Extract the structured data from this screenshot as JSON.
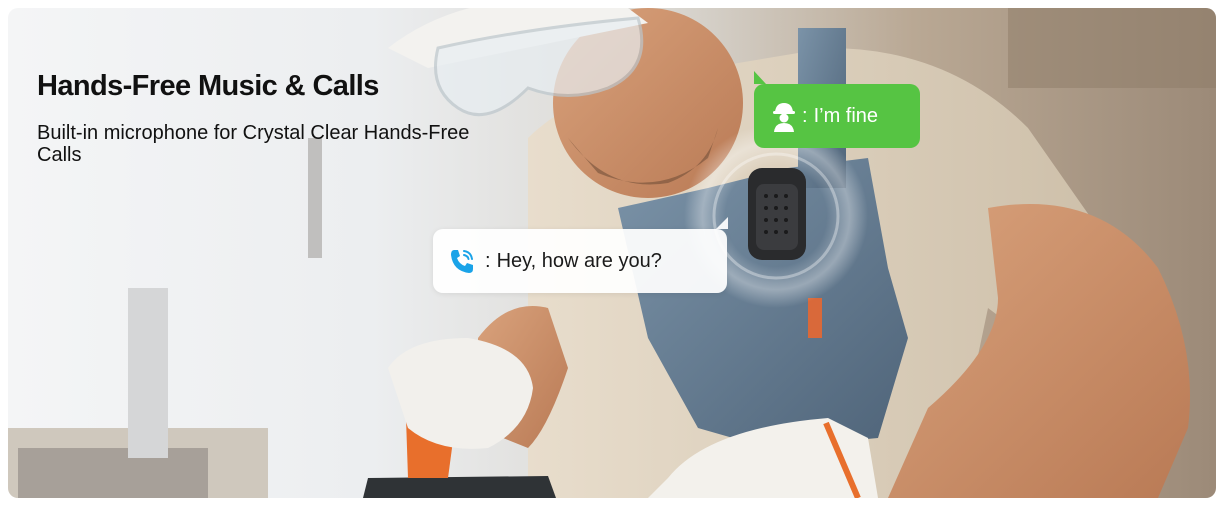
{
  "banner": {
    "headline": "Hands-Free Music & Calls",
    "subline": "Built-in microphone for Crystal Clear Hands-Free Calls"
  },
  "chat": {
    "reply_prefix": ":",
    "reply_text": "I’m fine",
    "call_prefix": ":",
    "call_text": "Hey, how are you?"
  },
  "icons": {
    "reply": "worker-icon",
    "call": "phone-call-icon"
  },
  "colors": {
    "reply_bubble": "#56c443",
    "call_icon": "#1aa3e8"
  }
}
